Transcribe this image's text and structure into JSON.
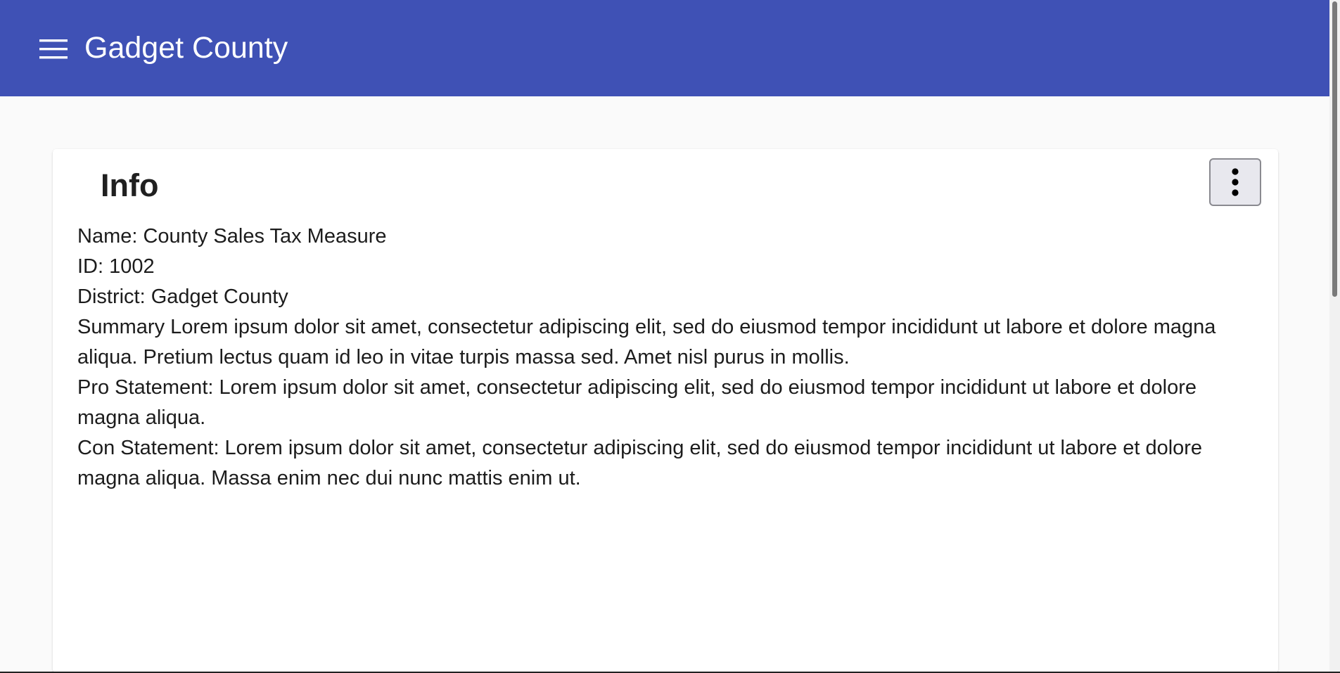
{
  "app_bar": {
    "title": "Gadget County",
    "menu_icon": "menu-icon",
    "color": "#3f51b5"
  },
  "info_card": {
    "title": "Info",
    "more_icon": "more-vert-icon",
    "lines": [
      "Name: County Sales Tax Measure",
      "ID: 1002",
      "District: Gadget County",
      "Summary Lorem ipsum dolor sit amet, consectetur adipiscing elit, sed do eiusmod tempor incididunt ut labore et dolore magna aliqua. Pretium lectus quam id leo in vitae turpis massa sed. Amet nisl purus in mollis.",
      "Pro Statement: Lorem ipsum dolor sit amet, consectetur adipiscing elit, sed do eiusmod tempor incididunt ut labore et dolore magna aliqua.",
      "Con Statement: Lorem ipsum dolor sit amet, consectetur adipiscing elit, sed do eiusmod tempor incididunt ut labore et dolore magna aliqua. Massa enim nec dui nunc mattis enim ut."
    ]
  }
}
